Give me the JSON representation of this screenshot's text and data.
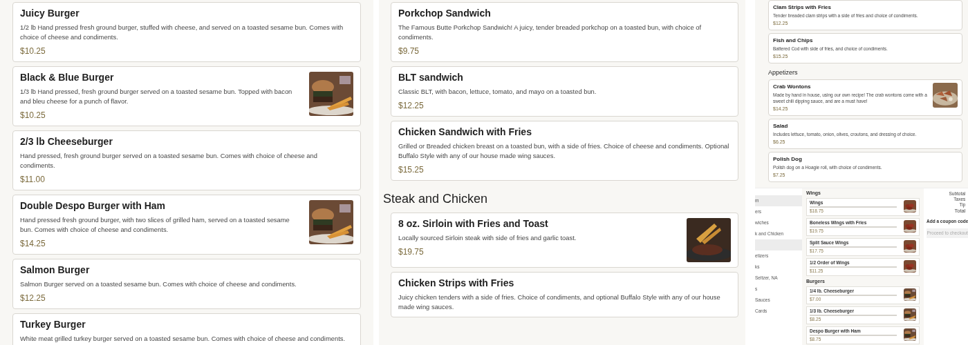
{
  "columns": [
    {
      "blocks": [
        {
          "items": [
            {
              "name": "Juicy Burger",
              "description": "1/2 lb Hand pressed fresh ground burger, stuffed with cheese, and served on a toasted sesame bun. Comes with choice of cheese and condiments.",
              "price": "$10.25"
            },
            {
              "name": "Black & Blue Burger",
              "description": "1/3 lb Hand pressed, fresh ground burger served on a toasted sesame bun. Topped with bacon and bleu cheese for a punch of flavor.",
              "price": "$10.25"
            },
            {
              "name": "2/3 lb Cheeseburger",
              "description": "Hand pressed, fresh ground burger served on a toasted sesame bun. Comes with choice of cheese and condiments.",
              "price": "$11.00"
            },
            {
              "name": "Double Despo Burger with Ham",
              "description": "Hand pressed fresh ground burger, with two slices of grilled ham, served on a toasted sesame bun. Comes with choice of cheese and condiments.",
              "price": "$14.25"
            },
            {
              "name": "Salmon Burger",
              "description": "Salmon Burger served on a toasted sesame bun. Comes with choice of cheese and condiments.",
              "price": "$12.25"
            },
            {
              "name": "Turkey Burger",
              "description": "White meat grilled turkey burger served on a toasted sesame bun. Comes with choice of cheese and condiments."
            }
          ]
        }
      ]
    },
    {
      "blocks": [
        {
          "items": [
            {
              "name": "Porkchop Sandwich",
              "description": "The Famous Butte Porkchop Sandwich! A juicy, tender breaded porkchop on a toasted bun, with choice of condiments.",
              "price": "$9.75"
            },
            {
              "name": "BLT sandwich",
              "description": "Classic BLT, with bacon, lettuce, tomato, and mayo on a toasted bun.",
              "price": "$12.25"
            },
            {
              "name": "Chicken Sandwich with Fries",
              "description": "Grilled or Breaded chicken breast on a toasted bun, with a side of fries. Choice of cheese and condiments. Optional Buffalo Style with any of our house made wing sauces.",
              "price": "$15.25"
            }
          ]
        },
        {
          "heading": "Steak and Chicken",
          "items": [
            {
              "name": "8 oz. Sirloin with Fries and Toast",
              "description": "Locally sourced Sirloin steak with side of fries and garlic toast.",
              "price": "$19.75"
            },
            {
              "name": "Chicken Strips with Fries",
              "description": "Juicy chicken tenders with a side of fries. Choice of condiments, and optional Buffalo Style with any of our house made wing sauces."
            }
          ]
        }
      ]
    },
    {
      "blocks": [
        {
          "items": [
            {
              "name": "Clam Strips with Fries",
              "description": "Tender breaded clam strips with a side of fries and choice of condiments.",
              "price": "$12.25"
            },
            {
              "name": "Fish and Chips",
              "description": "Battered Cod with side of fries, and choice of condiments.",
              "price": "$15.25"
            }
          ]
        },
        {
          "heading": "Appetizers",
          "items": [
            {
              "name": "Crab Wontons",
              "description": "Made by hand in house, using our own recipe! The crab wontons come with a sweet chili dipping sauce, and are a must have!",
              "price": "$14.25"
            },
            {
              "name": "Salad",
              "description": "Includes lettuce, tomato, onion, olives, croutons, and dressing of choice.",
              "price": "$6.25"
            },
            {
              "name": "Polish Dog",
              "description": "Polish dog on a Hoagie roll, with choice of condiments.",
              "price": "$7.25"
            }
          ]
        }
      ]
    }
  ],
  "preview": {
    "sidebar": [
      {
        "label": "m",
        "selected": true
      },
      {
        "label": "ers",
        "selected": false
      },
      {
        "label": "wiches",
        "selected": false
      },
      {
        "label": "k and Chicken",
        "selected": false
      },
      {
        "selected": true
      },
      {
        "label": "etizers",
        "selected": false
      },
      {
        "label": "ks",
        "selected": false
      },
      {
        "label": "Seltzer, NA",
        "selected": false
      },
      {
        "label": "s",
        "selected": false
      },
      {
        "label": "Sauces",
        "selected": false
      },
      {
        "label": "Cards",
        "selected": false
      }
    ],
    "sections": [
      {
        "heading": "Wings",
        "items": [
          {
            "name": "Wings",
            "price": "$18.75"
          },
          {
            "name": "Boneless Wings with Fries",
            "price": "$19.75"
          },
          {
            "name": "Split Sauce Wings",
            "price": "$17.75"
          },
          {
            "name": "1/2 Order of Wings",
            "price": "$11.25"
          }
        ]
      },
      {
        "heading": "Burgers",
        "items": [
          {
            "name": "1/4 lb. Cheeseburger",
            "price": "$7.00"
          },
          {
            "name": "1/3 lb. Cheeseburger",
            "price": "$8.25"
          },
          {
            "name": "Despo Burger with Ham",
            "price": "$8.75"
          }
        ]
      }
    ],
    "cart": {
      "lines": [
        "Subtotal",
        "Taxes",
        "Tip"
      ],
      "total": "Total",
      "coupon": "Add a coupon code",
      "checkout": {
        "label": "Proceed to checkout",
        "disabled": true
      }
    }
  }
}
